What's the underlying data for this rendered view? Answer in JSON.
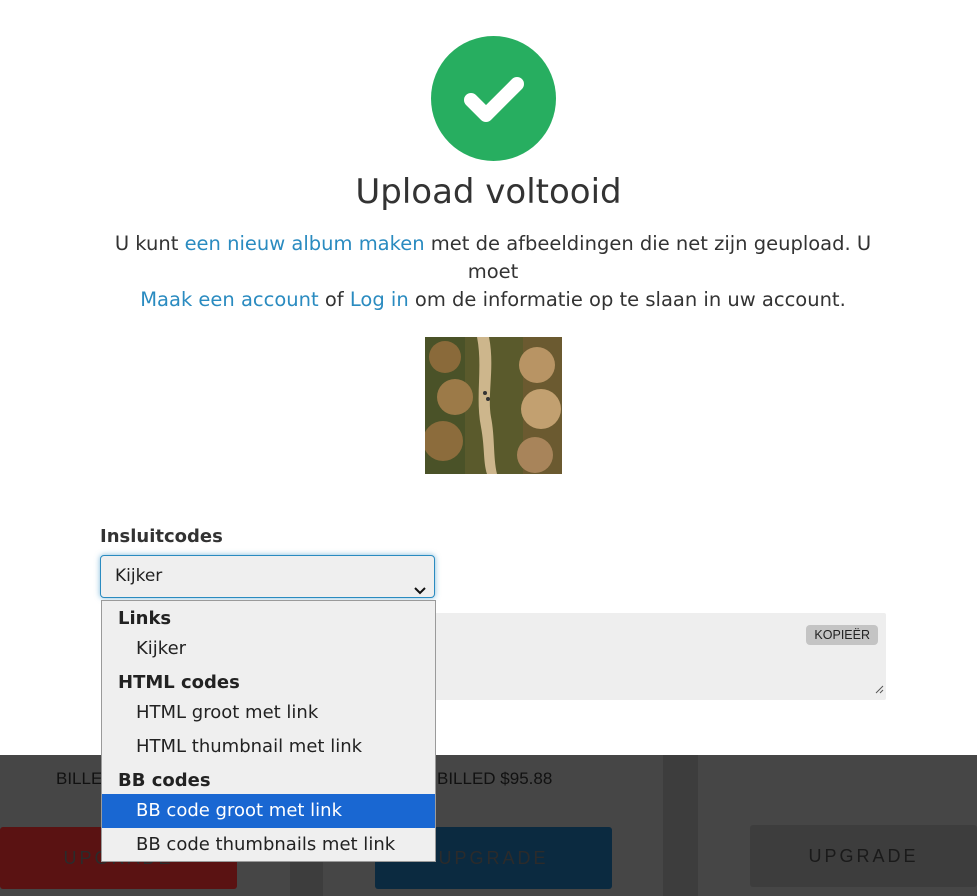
{
  "success": {
    "title": "Upload voltooid",
    "intro_1": "U kunt ",
    "link_new_album": "een nieuw album maken",
    "intro_2": " met de afbeeldingen die net zijn geupload. U moet",
    "link_create_account": "Maak een account",
    "intro_3": " of ",
    "link_login": "Log in",
    "intro_4": " om de informatie op te slaan in uw account."
  },
  "embed": {
    "label": "Insluitcodes",
    "selected_value": "Kijker",
    "copy_label": "KOPIEËR",
    "code_value": ""
  },
  "dropdown": {
    "groups": [
      {
        "label": "Links",
        "options": [
          "Kijker"
        ]
      },
      {
        "label": "HTML codes",
        "options": [
          "HTML groot met link",
          "HTML thumbnail met link"
        ]
      },
      {
        "label": "BB codes",
        "options": [
          "BB code groot met link",
          "BB code thumbnails met link"
        ]
      }
    ],
    "highlighted_option": "BB code groot met link"
  },
  "pricing": {
    "billed_left": "BILLE",
    "billed_middle": "BILLED $95.88",
    "upgrade_left": "UPGRADE",
    "upgrade_middle": "UPGRADE",
    "upgrade_right": "UPGRADE"
  },
  "colors": {
    "success_green": "#27ae60",
    "link_blue": "#2a8bc0",
    "selected_option": "#1967d2"
  }
}
